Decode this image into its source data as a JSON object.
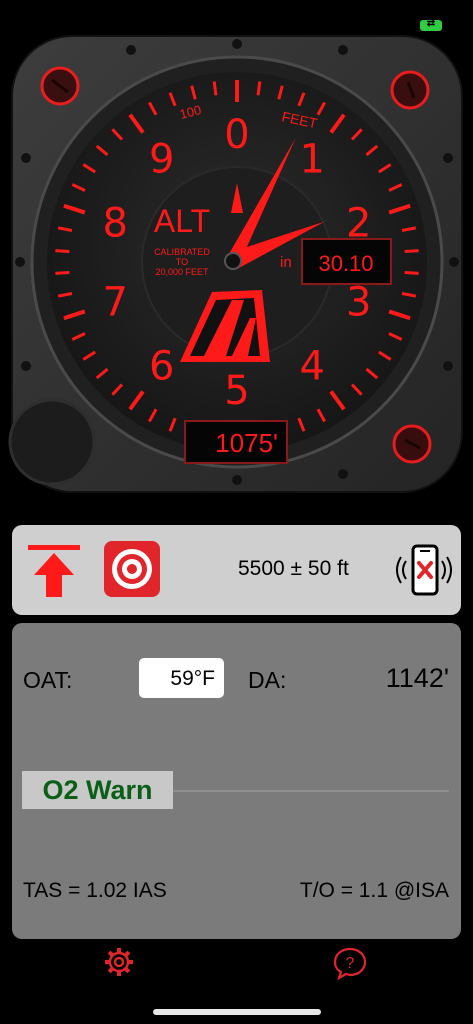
{
  "gauge": {
    "title": "ALT",
    "scale_label": "FEET",
    "scale_100": "100",
    "calibration": [
      "CALIBRATED",
      "TO",
      "20,000 FEET"
    ],
    "digits": [
      "0",
      "1",
      "2",
      "3",
      "4",
      "5",
      "6",
      "7",
      "8",
      "9"
    ],
    "pressure_unit": "in",
    "pressure_setting": "30.10",
    "altitude_readout": "1075'",
    "altitude_ft": 1075
  },
  "toolbar": {
    "target_altitude": "5500 ± 50 ft",
    "climb_icon": "climb-arrow-icon",
    "target_icon": "target-icon",
    "phone_icon": "phone-vibrate-off-icon"
  },
  "panel": {
    "oat_label": "OAT:",
    "oat_value": "59°F",
    "da_label": "DA:",
    "da_value": "1142'",
    "o2_warn": "O2 Warn",
    "tas": "TAS = 1.02 IAS",
    "takeoff": "T/O =  1.1 @ISA"
  },
  "bottom": {
    "settings_icon": "gear-icon",
    "help_icon": "question-bubble-icon"
  },
  "colors": {
    "accent_red": "#ff1a1a",
    "o2_green": "#0a5e16"
  }
}
